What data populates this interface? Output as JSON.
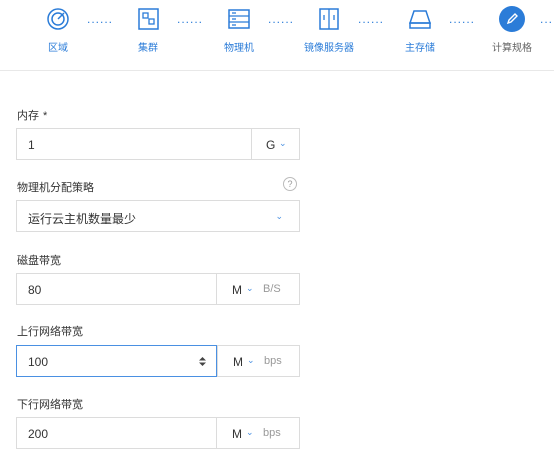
{
  "steps": [
    {
      "label": "区域",
      "icon": "target-icon"
    },
    {
      "label": "集群",
      "icon": "cluster-icon"
    },
    {
      "label": "物理机",
      "icon": "server-icon"
    },
    {
      "label": "镜像服务器",
      "icon": "image-server-icon"
    },
    {
      "label": "主存储",
      "icon": "primary-storage-icon"
    },
    {
      "label": "计算规格",
      "icon": "pencil-icon",
      "active": true
    }
  ],
  "step_separator": "......",
  "colors": {
    "accent": "#2b7cd8",
    "focus_border": "#4a90e2",
    "border": "#dcdcdc"
  },
  "form": {
    "memory": {
      "label": "内存",
      "required_mark": "*",
      "value": "1",
      "unit": "G",
      "caret": "⌄"
    },
    "allocation": {
      "label": "物理机分配策略",
      "help": "?",
      "value": "运行云主机数量最少",
      "caret": "⌄"
    },
    "disk_bw": {
      "label": "磁盘带宽",
      "value": "80",
      "unit": "M",
      "caret": "⌄",
      "suffix": "B/S"
    },
    "up_bw": {
      "label": "上行网络带宽",
      "value": "100",
      "unit": "M",
      "caret": "⌄",
      "suffix": "bps"
    },
    "down_bw": {
      "label": "下行网络带宽",
      "value": "200",
      "unit": "M",
      "caret": "⌄",
      "suffix": "bps"
    }
  }
}
